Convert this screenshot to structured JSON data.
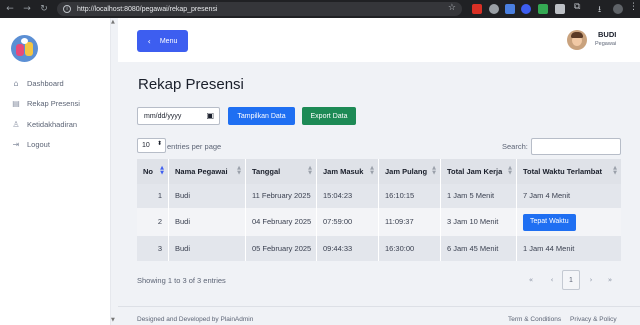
{
  "browser": {
    "url": "http://localhost:8080/pegawai/rekap_presensi",
    "back_icon": "arrow-left-icon",
    "forward_icon": "arrow-right-icon",
    "reload_icon": "reload-icon"
  },
  "sidebar": {
    "items": [
      {
        "label": "Dashboard",
        "icon": "home-icon"
      },
      {
        "label": "Rekap Presensi",
        "icon": "clipboard-icon"
      },
      {
        "label": "Ketidakhadiran",
        "icon": "user-x-icon"
      },
      {
        "label": "Logout",
        "icon": "logout-icon"
      }
    ]
  },
  "header": {
    "menu_label": "Menu",
    "user_name": "BUDI",
    "user_role": "Pegawai"
  },
  "main": {
    "title": "Rekap Presensi",
    "date_placeholder": "mm/dd/yyyy",
    "show_button": "Tampilkan Data",
    "export_button": "Export Data",
    "page_length": "10",
    "page_length_label": "entries per page",
    "search_label": "Search:"
  },
  "table": {
    "columns": [
      "No",
      "Nama Pegawai",
      "Tanggal",
      "Jam Masuk",
      "Jam Pulang",
      "Total Jam Kerja",
      "Total Waktu Terlambat"
    ],
    "rows": [
      {
        "no": "1",
        "nama": "Budi",
        "tanggal": "11 February 2025",
        "masuk": "15:04:23",
        "pulang": "16:10:15",
        "kerja": "1 Jam 5 Menit",
        "terlambat": "7 Jam 4 Menit"
      },
      {
        "no": "2",
        "nama": "Budi",
        "tanggal": "04 February 2025",
        "masuk": "07:59:00",
        "pulang": "11:09:37",
        "kerja": "3 Jam 10 Menit",
        "terlambat": "Tepat Waktu"
      },
      {
        "no": "3",
        "nama": "Budi",
        "tanggal": "05 February 2025",
        "masuk": "09:44:33",
        "pulang": "16:30:00",
        "kerja": "6 Jam 45 Menit",
        "terlambat": "1 Jam 44 Menit"
      }
    ]
  },
  "pagination": {
    "info": "Showing 1 to 3 of 3 entries",
    "first": "«",
    "prev": "‹",
    "current": "1",
    "next": "›",
    "last": "»"
  },
  "footer": {
    "credit": "Designed and Developed by PlainAdmin",
    "terms": "Term & Conditions",
    "privacy": "Privacy & Policy"
  },
  "colors": {
    "primary": "#3d5ef0",
    "blue_button": "#1f6ff2",
    "green_button": "#1d8a55"
  }
}
